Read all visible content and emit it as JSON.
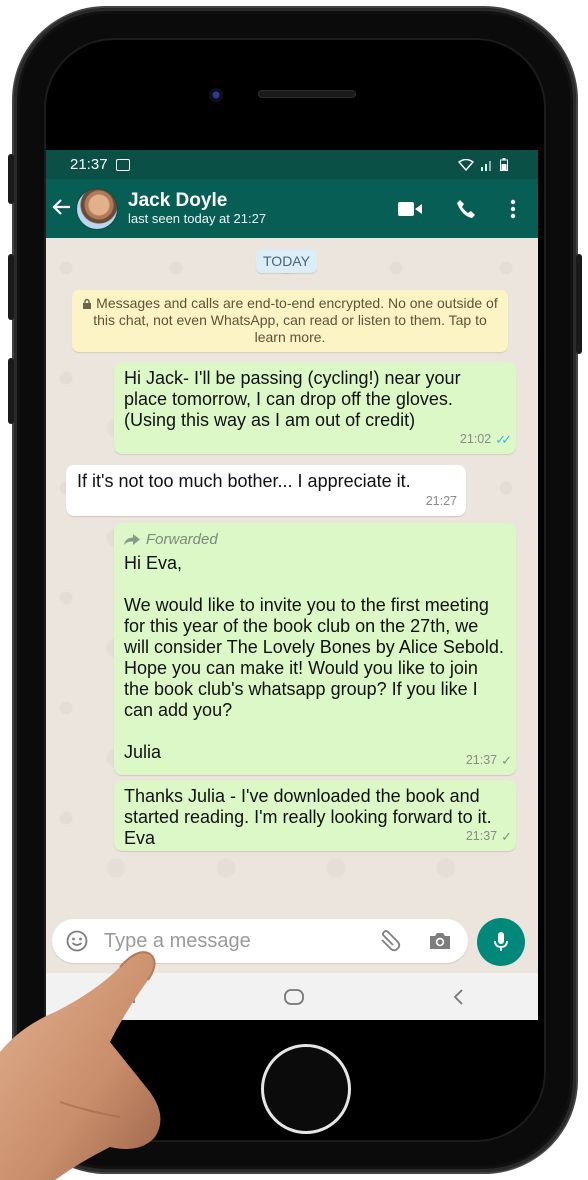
{
  "status": {
    "time": "21:37"
  },
  "contact": {
    "name": "Jack Doyle",
    "last_seen": "last seen today at 21:27"
  },
  "date_label": "TODAY",
  "encryption_notice": "Messages and calls are end-to-end encrypted. No one outside of this chat, not even WhatsApp, can read or listen to them. Tap to learn more.",
  "messages": [
    {
      "direction": "out",
      "text": "Hi Jack- I'll be passing (cycling!) near your place tomorrow, I can drop off the gloves. (Using this way as I am out of credit)",
      "time": "21:02",
      "status": "read"
    },
    {
      "direction": "in",
      "text": "If it's not too much bother... I appreciate it.",
      "time": "21:27"
    },
    {
      "direction": "out",
      "forwarded": "Forwarded",
      "text_lines": [
        "Hi Eva,",
        "",
        "We would like to invite you to the first meeting for this year of the book club on the 27th, we will consider The Lovely Bones by Alice Sebold. Hope you can make it! Would you like to join the book club's whatsapp group? If you like I can add you?",
        "",
        "Julia"
      ],
      "time": "21:37",
      "status": "sent"
    },
    {
      "direction": "out",
      "text": "Thanks Julia - I've downloaded the book and started reading. I'm really looking forward to it. Eva",
      "time": "21:37",
      "status": "sent"
    }
  ],
  "composer": {
    "placeholder": "Type a message"
  },
  "icons": [
    "back-arrow-icon",
    "video-call-icon",
    "phone-icon",
    "more-vert-icon",
    "emoji-icon",
    "attach-icon",
    "camera-icon",
    "mic-icon"
  ],
  "colors": {
    "header": "#075e54",
    "status_bar": "#0a5046",
    "outgoing": "#dcf8c6",
    "incoming": "#ffffff",
    "mic_button": "#00897b",
    "read_tick": "#34b7f1"
  }
}
